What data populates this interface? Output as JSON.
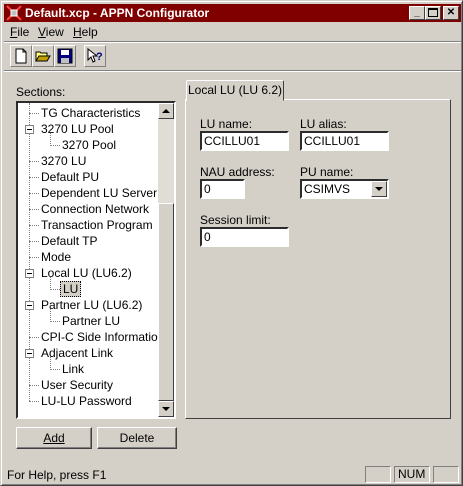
{
  "window": {
    "title": "Default.xcp - APPN Configurator",
    "icon": "appn-app-icon",
    "controls": [
      "minimize-icon",
      "maximize-icon",
      "close-icon"
    ]
  },
  "menu": {
    "items": [
      {
        "label": "File",
        "accel": "F"
      },
      {
        "label": "View",
        "accel": "V"
      },
      {
        "label": "Help",
        "accel": "H"
      }
    ]
  },
  "toolbar": {
    "buttons": [
      "new-file-icon",
      "open-folder-icon",
      "save-disk-icon",
      "context-help-icon"
    ]
  },
  "sections": {
    "label": "Sections:",
    "items": [
      {
        "label": "TG Characteristics"
      },
      {
        "label": "3270 LU Pool",
        "expanded": true
      },
      {
        "label": "3270 Pool"
      },
      {
        "label": "3270 LU"
      },
      {
        "label": "Default PU"
      },
      {
        "label": "Dependent LU Server"
      },
      {
        "label": "Connection Network"
      },
      {
        "label": "Transaction Program"
      },
      {
        "label": "Default TP"
      },
      {
        "label": "Mode"
      },
      {
        "label": "Local LU (LU6.2)",
        "expanded": true
      },
      {
        "label": "LU",
        "selected": true
      },
      {
        "label": "Partner LU (LU6.2)",
        "expanded": true
      },
      {
        "label": "Partner LU"
      },
      {
        "label": "CPI-C Side Information"
      },
      {
        "label": "Adjacent Link",
        "expanded": true
      },
      {
        "label": "Link"
      },
      {
        "label": "User Security"
      },
      {
        "label": "LU-LU Password"
      }
    ]
  },
  "buttons": {
    "add": "Add",
    "delete": "Delete"
  },
  "tab": {
    "label": "Local LU (LU 6.2)"
  },
  "form": {
    "lu_name_label": "LU name:",
    "lu_name_value": "CCILLU01",
    "lu_alias_label": "LU alias:",
    "lu_alias_value": "CCILLU01",
    "nau_label": "NAU address:",
    "nau_value": "0",
    "pu_label": "PU name:",
    "pu_value": "CSIMVS",
    "session_label": "Session limit:",
    "session_value": "0"
  },
  "status": {
    "text": "For Help, press F1",
    "num": "NUM"
  },
  "colors": {
    "titlebar": "#800000",
    "face": "#d4d0c8",
    "selection": "#000080"
  }
}
